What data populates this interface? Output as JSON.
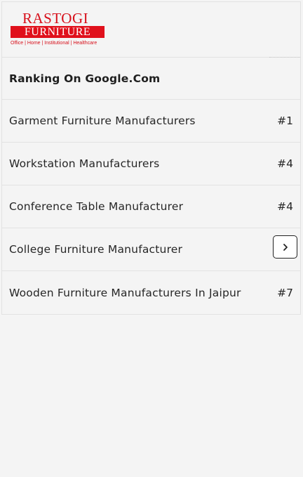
{
  "logo": {
    "top": "RASTOGI",
    "bar": "FURNITURE",
    "tagline": "Office | Home | Institutional | Healthcare"
  },
  "heading": "Ranking On Google.Com",
  "rows": [
    {
      "label": "Garment Furniture Manufacturers",
      "rank": "#1"
    },
    {
      "label": "Workstation Manufacturers",
      "rank": "#4"
    },
    {
      "label": "Conference Table Manufacturer",
      "rank": "#4"
    },
    {
      "label": "College Furniture Manufacturer",
      "rank": ""
    },
    {
      "label": "Wooden Furniture Manufacturers In Jaipur",
      "rank": "#7"
    }
  ],
  "next_button_icon": "chevron-right-icon"
}
